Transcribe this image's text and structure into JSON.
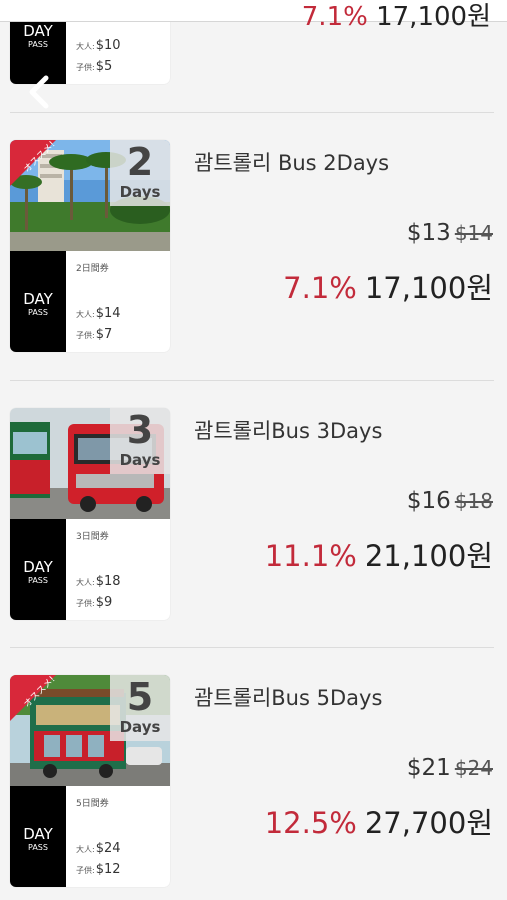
{
  "header_fragment": {
    "percent": "7.1%",
    "price": "17,100원"
  },
  "top_card": {
    "day_label": "DAY",
    "pass_label": "PASS",
    "adult_key": "大人:",
    "adult_price": "$10",
    "child_key": "子供:",
    "child_price": "$5"
  },
  "products": [
    {
      "badge": "オススメ!",
      "days_number": "2",
      "days_word": "Days",
      "ticket_title": "2日間券",
      "day_label": "DAY",
      "pass_label": "PASS",
      "adult_key": "大人:",
      "adult_price": "$14",
      "child_key": "子供:",
      "child_price": "$7",
      "name": "괌트롤리 Bus 2Days",
      "usd_price": "$13",
      "usd_original": "$14",
      "discount": "7.1%",
      "krw_price": "17,100원"
    },
    {
      "badge": "",
      "days_number": "3",
      "days_word": "Days",
      "ticket_title": "3日間券",
      "day_label": "DAY",
      "pass_label": "PASS",
      "adult_key": "大人:",
      "adult_price": "$18",
      "child_key": "子供:",
      "child_price": "$9",
      "name": "괌트롤리Bus 3Days",
      "usd_price": "$16",
      "usd_original": "$18",
      "discount": "11.1%",
      "krw_price": "21,100원"
    },
    {
      "badge": "オススメ!",
      "days_number": "5",
      "days_word": "Days",
      "ticket_title": "5日間券",
      "day_label": "DAY",
      "pass_label": "PASS",
      "adult_key": "大人:",
      "adult_price": "$24",
      "child_key": "子供:",
      "child_price": "$12",
      "name": "괌트롤리Bus 5Days",
      "usd_price": "$21",
      "usd_original": "$24",
      "discount": "12.5%",
      "krw_price": "27,700원"
    }
  ],
  "colors": {
    "discount": "#c22a3a",
    "badge": "#d8283a",
    "background": "#f4f4f4"
  },
  "icons": {
    "back": "chevron-left-icon"
  }
}
